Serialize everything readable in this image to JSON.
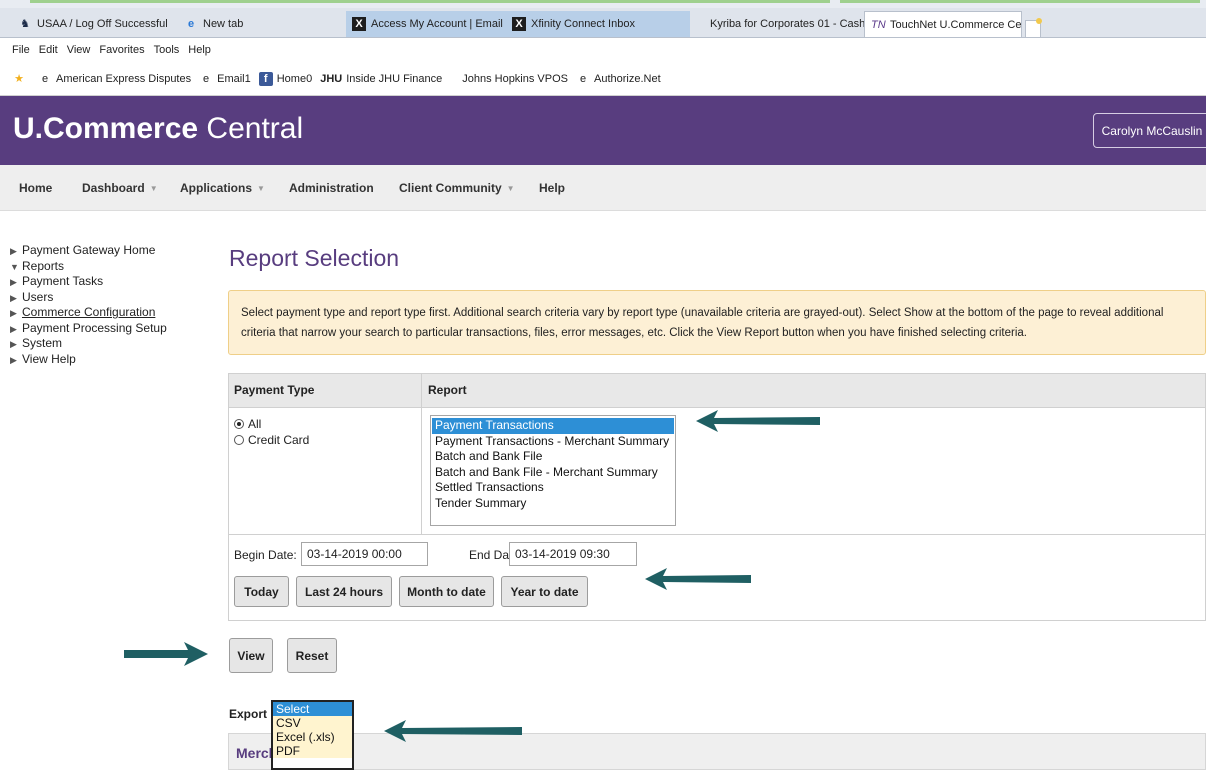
{
  "browser": {
    "tabs": [
      {
        "label": "USAA / Log Off Successful",
        "icon": "usaa-icon"
      },
      {
        "label": "New tab",
        "icon": "ie-icon"
      },
      {
        "label": "Access My Account | Email | O...",
        "icon": "xfinity-icon"
      },
      {
        "label": "Xfinity Connect Inbox",
        "icon": "xfinity-icon"
      },
      {
        "label": "Kyriba for Corporates 01 - Cash...",
        "icon": ""
      },
      {
        "label": "TouchNet U.Commerce Ce...",
        "icon": "touchnet-icon"
      }
    ],
    "menu": [
      "File",
      "Edit",
      "View",
      "Favorites",
      "Tools",
      "Help"
    ],
    "favorites": [
      {
        "label": "American Express Disputes",
        "icon": "ie-icon"
      },
      {
        "label": "Email1",
        "icon": "ie-icon"
      },
      {
        "label": "Home0",
        "icon": "facebook-icon"
      },
      {
        "label": "Inside JHU Finance",
        "icon": "jhu-icon",
        "badge": "JHU"
      },
      {
        "label": "Johns Hopkins VPOS",
        "icon": ""
      },
      {
        "label": "Authorize.Net",
        "icon": "ie-icon"
      }
    ]
  },
  "header": {
    "brand_bold": "U.Commerce",
    "brand_light": "Central",
    "user": "Carolyn McCauslin"
  },
  "nav": [
    {
      "label": "Home"
    },
    {
      "label": "Dashboard",
      "caret": "▼"
    },
    {
      "label": "Applications",
      "caret": "▼"
    },
    {
      "label": "Administration"
    },
    {
      "label": "Client Community",
      "caret": "▼"
    },
    {
      "label": "Help"
    }
  ],
  "sidebar": [
    {
      "label": "Payment Gateway Home",
      "marker": "▶"
    },
    {
      "label": "Reports",
      "marker": "▼"
    },
    {
      "label": "Payment Tasks",
      "marker": "▶"
    },
    {
      "label": "Users",
      "marker": "▶"
    },
    {
      "label": "Commerce Configuration",
      "marker": "▶"
    },
    {
      "label": "Payment Processing Setup",
      "marker": "▶"
    },
    {
      "label": "System",
      "marker": "▶"
    },
    {
      "label": "View Help",
      "marker": "▶"
    }
  ],
  "page": {
    "title": "Report Selection",
    "info": "Select payment type and report type first. Additional search criteria vary by report type (unavailable criteria are grayed-out). Select Show at the bottom of the page to reveal additional criteria that narrow your search to particular transactions, files, error messages, etc. Click the View Report button when you have finished selecting criteria."
  },
  "criteria": {
    "payment_type_header": "Payment Type",
    "report_header": "Report",
    "payment_types": [
      {
        "label": "All",
        "checked": true
      },
      {
        "label": "Credit Card",
        "checked": false
      }
    ],
    "reports": [
      {
        "label": "Payment Transactions",
        "selected": true
      },
      {
        "label": "Payment Transactions - Merchant Summary",
        "selected": false
      },
      {
        "label": "Batch and Bank File",
        "selected": false
      },
      {
        "label": "Batch and Bank File - Merchant Summary",
        "selected": false
      },
      {
        "label": "Settled Transactions",
        "selected": false
      },
      {
        "label": "Tender Summary",
        "selected": false
      }
    ],
    "begin_date_label": "Begin Date:",
    "begin_date": "03-14-2019 00:00",
    "end_date_label": "End Date:",
    "end_date": "03-14-2019 09:30",
    "quick_buttons": [
      "Today",
      "Last 24 hours",
      "Month to date",
      "Year to date"
    ]
  },
  "actions": {
    "view": "View",
    "reset": "Reset"
  },
  "export": {
    "label": "Export",
    "options": [
      {
        "label": "Select",
        "selected": true
      },
      {
        "label": "CSV",
        "selected": false
      },
      {
        "label": "Excel (.xls)",
        "selected": false
      },
      {
        "label": "PDF",
        "selected": false
      }
    ]
  },
  "merchant_section": {
    "title": "Merchants"
  },
  "colors": {
    "brand_purple": "#583d7f",
    "annotation_arrow": "#1f5f63",
    "selection_blue": "#2d8fd6"
  }
}
